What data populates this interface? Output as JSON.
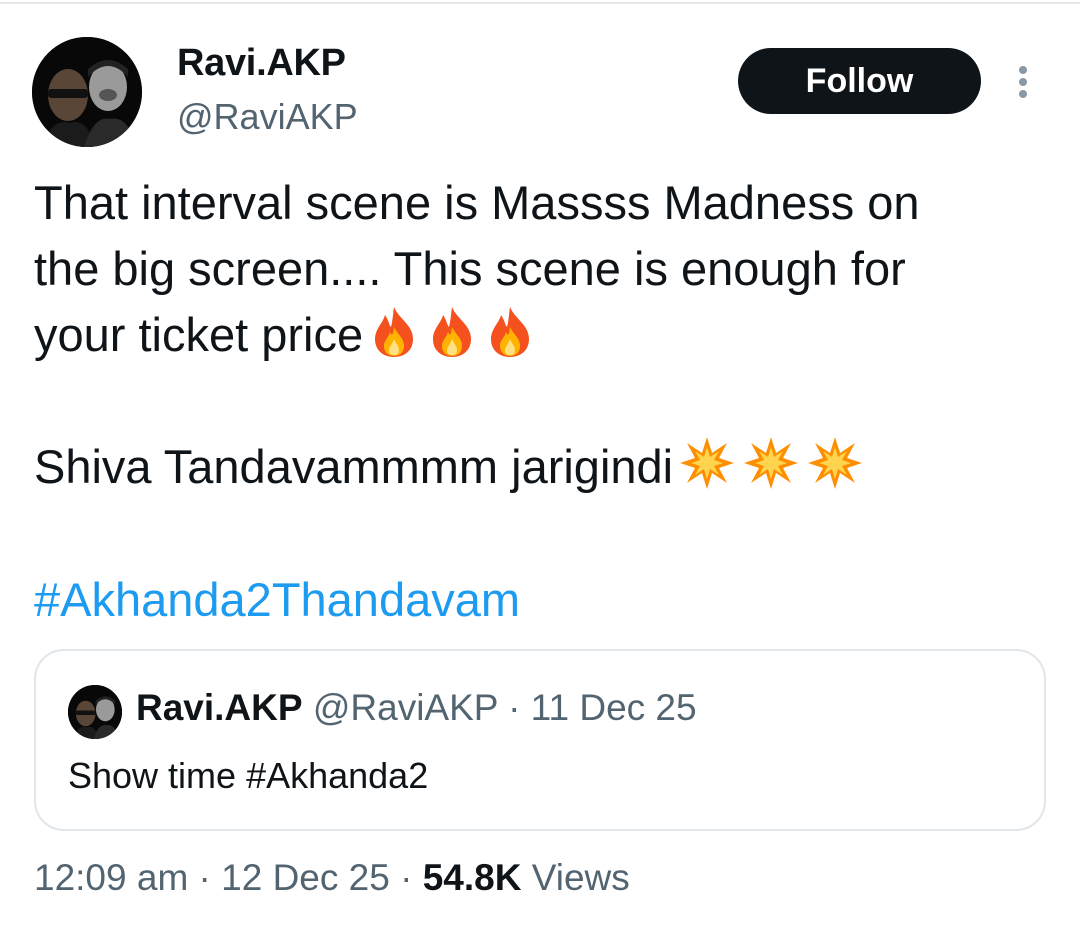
{
  "author": {
    "display_name": "Ravi.AKP",
    "handle": "@RaviAKP"
  },
  "follow_label": "Follow",
  "icons": {
    "more": "more-vertical-icon",
    "fire": "fire-emoji-icon",
    "collision": "collision-emoji-icon"
  },
  "tweet": {
    "line1": "That interval scene is Massss Madness on",
    "line2": "the big screen.... This scene is enough for",
    "line3": "your ticket price",
    "line4": "Shiva Tandavammmm jarigindi",
    "hashtag": "#Akhanda2Thandavam"
  },
  "quote": {
    "display_name": "Ravi.AKP",
    "meta": " @RaviAKP · 11 Dec 25",
    "text": "Show time #Akhanda2"
  },
  "footer": {
    "time_date": "12:09 am · 12 Dec 25 · ",
    "views_count": "54.8K",
    "views_label": " Views"
  },
  "colors": {
    "text": "#0f1419",
    "secondary": "#536471",
    "link": "#1d9bf0",
    "border": "#e1e6ea"
  }
}
